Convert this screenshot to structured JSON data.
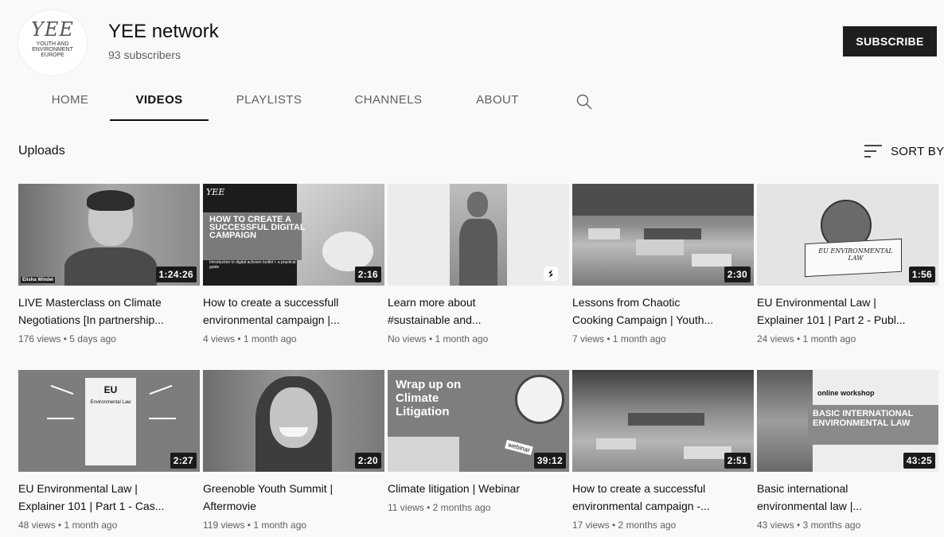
{
  "channel": {
    "name": "YEE network",
    "subscribers": "93 subscribers",
    "avatar_logo": "YEE",
    "avatar_sub": "YOUTH AND ENVIRONMENT EUROPE",
    "subscribe_label": "SUBSCRIBE"
  },
  "tabs": [
    {
      "label": "HOME"
    },
    {
      "label": "VIDEOS"
    },
    {
      "label": "PLAYLISTS"
    },
    {
      "label": "CHANNELS"
    },
    {
      "label": "ABOUT"
    }
  ],
  "section": {
    "title": "Uploads",
    "sort_label": "SORT BY"
  },
  "videos": [
    {
      "title_line1": "LIVE Masterclass on Climate",
      "title_line2": "Negotiations [In partnership...",
      "meta": "176 views • 5 days ago",
      "duration": "1:24:26",
      "thumb_caption": "Elisha Windel"
    },
    {
      "title_line1": "How to create a successfull",
      "title_line2": "environmental campaign |...",
      "meta": "4 views • 1 month ago",
      "duration": "2:16",
      "thumb_heading": "HOW TO CREATE A SUCCESSFUL DIGITAL CAMPAIGN",
      "thumb_sub": "Introduction to digital activism toolkit + a practical guide",
      "thumb_logo": "YEE"
    },
    {
      "title_line1": "Learn more about",
      "title_line2": "#sustainable and...",
      "meta": "No views • 1 month ago",
      "duration": ""
    },
    {
      "title_line1": "Lessons from Chaotic",
      "title_line2": "Cooking Campaign | Youth...",
      "meta": "7 views • 1 month ago",
      "duration": "2:30"
    },
    {
      "title_line1": "EU Environmental Law |",
      "title_line2": "Explainer 101 | Part 2 - Publ...",
      "meta": "24 views • 1 month ago",
      "duration": "1:56",
      "thumb_heading": "EU ENVIRONMENTAL LAW"
    },
    {
      "title_line1": "EU Environmental Law |",
      "title_line2": "Explainer 101 | Part 1 - Cas...",
      "meta": "48 views • 1 month ago",
      "duration": "2:27",
      "thumb_heading": "EU",
      "thumb_sub": "Environmental Law"
    },
    {
      "title_line1": "Greenoble Youth Summit |",
      "title_line2": "Aftermovie",
      "meta": "119 views • 1 month ago",
      "duration": "2:20"
    },
    {
      "title_line1": "Climate litigation | Webinar",
      "title_line2": "",
      "meta": "11 views • 2 months ago",
      "duration": "39:12",
      "thumb_heading": "Wrap up on Climate Litigation",
      "thumb_sub": "webinar"
    },
    {
      "title_line1": "How to create a successful",
      "title_line2": "environmental campaign -...",
      "meta": "17 views • 2 months ago",
      "duration": "2:51"
    },
    {
      "title_line1": "Basic international",
      "title_line2": "environmental law |...",
      "meta": "43 views • 3 months ago",
      "duration": "43:25",
      "thumb_heading": "BASIC INTERNATIONAL ENVIRONMENTAL LAW",
      "thumb_sub": "online workshop"
    }
  ],
  "colors": {
    "subscribe_bg": "#1e1e1e",
    "accent": "#0f0f0f",
    "meta_text": "#606060"
  },
  "icons": {
    "search": "search-icon",
    "sort": "sort-icon"
  }
}
